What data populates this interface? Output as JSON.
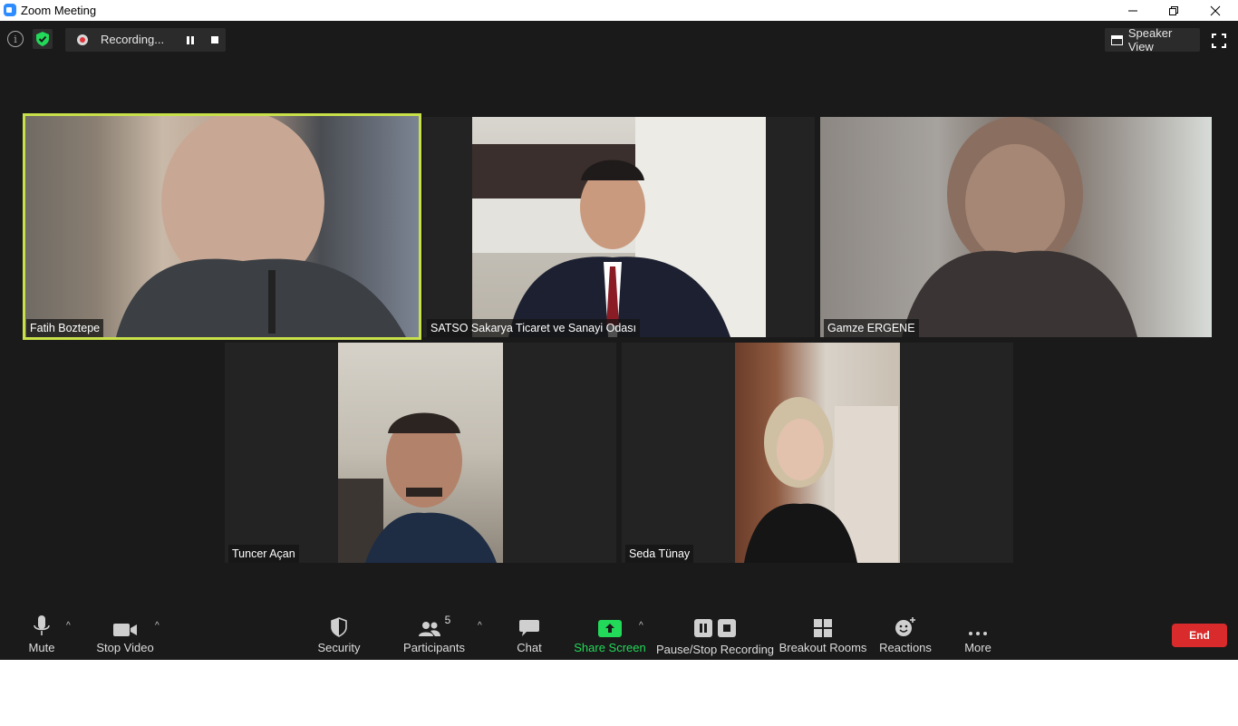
{
  "window": {
    "title": "Zoom Meeting"
  },
  "top_bar": {
    "recording_text": "Recording...",
    "speaker_view_label": "Speaker View"
  },
  "participants": [
    {
      "name": "Fatih Boztepe",
      "active_speaker": true
    },
    {
      "name": "SATSO Sakarya Ticaret ve Sanayi Odası",
      "active_speaker": false
    },
    {
      "name": "Gamze ERGENE",
      "active_speaker": false
    },
    {
      "name": "Tuncer Açan",
      "active_speaker": false
    },
    {
      "name": "Seda Tünay",
      "active_speaker": false
    }
  ],
  "toolbar": {
    "mute_label": "Mute",
    "stop_video_label": "Stop Video",
    "security_label": "Security",
    "participants_label": "Participants",
    "participants_count": "5",
    "chat_label": "Chat",
    "share_screen_label": "Share Screen",
    "pause_stop_recording_label": "Pause/Stop Recording",
    "breakout_rooms_label": "Breakout Rooms",
    "reactions_label": "Reactions",
    "more_label": "More",
    "end_label": "End"
  },
  "colors": {
    "meeting_bg": "#1a1a1a",
    "active_speaker_border": "#c8e04a",
    "share_screen_green": "#23d959",
    "end_red": "#d92b2b",
    "zoom_blue": "#2d8cff"
  }
}
